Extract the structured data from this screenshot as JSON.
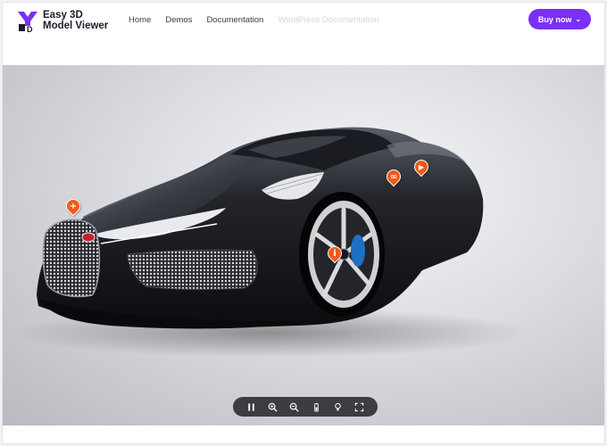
{
  "brand": {
    "line1": "Easy 3D",
    "line2": "Model Viewer",
    "accent": "#7b2ff7"
  },
  "nav": {
    "items": [
      {
        "label": "Home"
      },
      {
        "label": "Demos"
      },
      {
        "label": "Documentation"
      },
      {
        "label": "WordPress Documentation",
        "state": "faded"
      }
    ]
  },
  "cta": {
    "label": "Buy now",
    "icon": "chevron-down-icon"
  },
  "viewer": {
    "hotspot_color": "#f05a1a",
    "hotspots": [
      {
        "icon": "plus-icon",
        "glyph": "+"
      },
      {
        "icon": "link-icon",
        "glyph": "∞"
      },
      {
        "icon": "play-icon",
        "glyph": "▶"
      },
      {
        "icon": "info-icon",
        "glyph": "i"
      }
    ],
    "toolbar": [
      {
        "icon": "pause-icon"
      },
      {
        "icon": "zoom-in-icon"
      },
      {
        "icon": "zoom-out-icon"
      },
      {
        "icon": "battery-icon"
      },
      {
        "icon": "bulb-icon"
      },
      {
        "icon": "fullscreen-icon"
      }
    ]
  }
}
